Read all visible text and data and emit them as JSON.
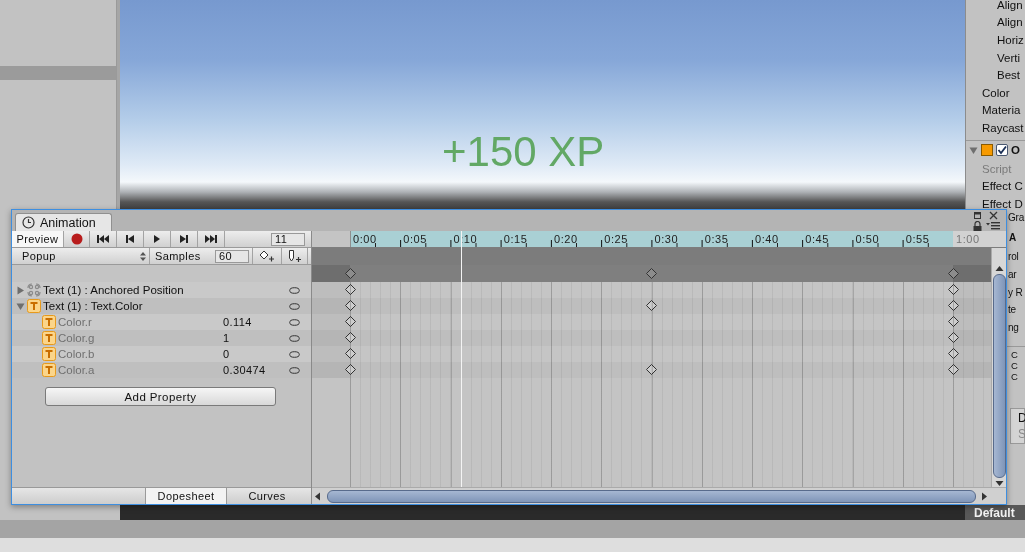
{
  "scene": {
    "overlay_text": "+150 XP"
  },
  "inspector": {
    "items": [
      {
        "kind": "sub",
        "text": "Align"
      },
      {
        "kind": "sub",
        "text": "Align"
      },
      {
        "kind": "sub",
        "text": "Horiz"
      },
      {
        "kind": "sub",
        "text": "Verti"
      },
      {
        "kind": "sub",
        "text": "Best"
      },
      {
        "kind": "field",
        "text": "Color"
      },
      {
        "kind": "field",
        "text": "Materia"
      },
      {
        "kind": "field",
        "text": "Raycast"
      },
      {
        "kind": "component",
        "text": "O",
        "enabled": true,
        "expanded": true
      },
      {
        "kind": "script",
        "text": "Script"
      },
      {
        "kind": "field",
        "text": "Effect C"
      },
      {
        "kind": "field",
        "text": "Effect D"
      }
    ],
    "covered_items": [
      {
        "kind": "field",
        "text": "Gra"
      },
      {
        "kind": "component",
        "text": "A"
      },
      {
        "kind": "field",
        "text": "rol"
      },
      {
        "kind": "field",
        "text": "ar"
      },
      {
        "kind": "field",
        "text": "y R"
      },
      {
        "kind": "field",
        "text": "te"
      },
      {
        "kind": "field",
        "text": "ng"
      },
      {
        "kind": "small",
        "text": "C"
      },
      {
        "kind": "small",
        "text": "C"
      },
      {
        "kind": "small",
        "text": "C"
      }
    ],
    "panel_lines": [
      "D",
      "S"
    ]
  },
  "status": {
    "layout": "Default"
  },
  "animation": {
    "tab": "Animation",
    "toolbar": {
      "preview": "Preview",
      "frame": "11"
    },
    "clip_row": {
      "clip": "Popup",
      "samples_label": "Samples",
      "samples": "60"
    },
    "properties": [
      {
        "label": "Text (1) : Anchored Position",
        "kind": "transform",
        "expanded": false,
        "keys": [
          {
            "level": 0
          },
          {
            "level": 1
          }
        ]
      },
      {
        "label": "Text (1) : Text.Color",
        "kind": "text",
        "expanded": true,
        "keys": [
          {
            "level": 0
          },
          {
            "level": 0.5
          },
          {
            "level": 1
          }
        ],
        "children": [
          {
            "label": "Color.r",
            "kind": "text",
            "value": "0.114",
            "keys": [
              {
                "level": 0
              },
              {
                "level": 1
              }
            ]
          },
          {
            "label": "Color.g",
            "kind": "text",
            "value": "1",
            "keys": [
              {
                "level": 0
              },
              {
                "level": 1
              }
            ]
          },
          {
            "label": "Color.b",
            "kind": "text",
            "value": "0",
            "keys": [
              {
                "level": 0
              },
              {
                "level": 1
              }
            ]
          },
          {
            "label": "Color.a",
            "kind": "text",
            "value": "0.30474",
            "keys": [
              {
                "level": 0
              },
              {
                "level": 0.5
              },
              {
                "level": 1
              }
            ]
          }
        ]
      }
    ],
    "add_property": "Add Property",
    "view_tabs": [
      {
        "label": "Dopesheet",
        "selected": true
      },
      {
        "label": "Curves",
        "selected": false
      }
    ],
    "timeline": {
      "ruler": [
        "0:00",
        "0:05",
        "0:10",
        "0:15",
        "0:20",
        "0:25",
        "0:30",
        "0:35",
        "0:40",
        "0:45",
        "0:50",
        "0:55",
        "1:00"
      ],
      "summary_keys": [
        {
          "level": 0
        },
        {
          "level": 0.5
        },
        {
          "level": 1
        }
      ],
      "playhead": {
        "level": 0.1833
      }
    }
  }
}
